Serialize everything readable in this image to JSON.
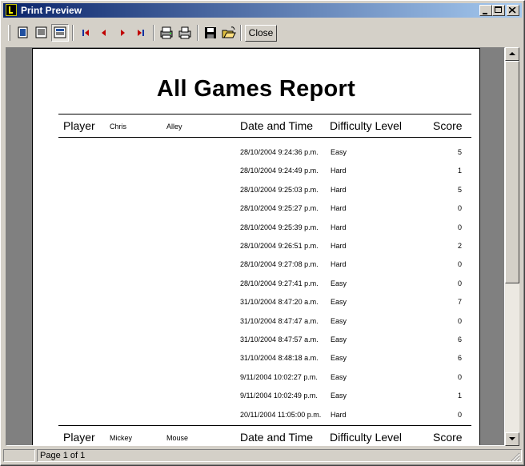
{
  "window": {
    "title": "Print Preview"
  },
  "toolbar": {
    "close_label": "Close"
  },
  "status": {
    "page_text": "Page 1 of 1"
  },
  "report": {
    "title": "All Games Report",
    "columns": {
      "player": "Player",
      "datetime": "Date and Time",
      "difficulty": "Difficulty Level",
      "score": "Score"
    },
    "groups": [
      {
        "first_name": "Chris",
        "last_name": "Alley",
        "rows": [
          {
            "datetime": "28/10/2004 9:24:36 p.m.",
            "difficulty": "Easy",
            "score": "5"
          },
          {
            "datetime": "28/10/2004 9:24:49 p.m.",
            "difficulty": "Hard",
            "score": "1"
          },
          {
            "datetime": "28/10/2004 9:25:03 p.m.",
            "difficulty": "Hard",
            "score": "5"
          },
          {
            "datetime": "28/10/2004 9:25:27 p.m.",
            "difficulty": "Hard",
            "score": "0"
          },
          {
            "datetime": "28/10/2004 9:25:39 p.m.",
            "difficulty": "Hard",
            "score": "0"
          },
          {
            "datetime": "28/10/2004 9:26:51 p.m.",
            "difficulty": "Hard",
            "score": "2"
          },
          {
            "datetime": "28/10/2004 9:27:08 p.m.",
            "difficulty": "Hard",
            "score": "0"
          },
          {
            "datetime": "28/10/2004 9:27:41 p.m.",
            "difficulty": "Easy",
            "score": "0"
          },
          {
            "datetime": "31/10/2004 8:47:20 a.m.",
            "difficulty": "Easy",
            "score": "7"
          },
          {
            "datetime": "31/10/2004 8:47:47 a.m.",
            "difficulty": "Easy",
            "score": "0"
          },
          {
            "datetime": "31/10/2004 8:47:57 a.m.",
            "difficulty": "Easy",
            "score": "6"
          },
          {
            "datetime": "31/10/2004 8:48:18 a.m.",
            "difficulty": "Easy",
            "score": "6"
          },
          {
            "datetime": "9/11/2004 10:02:27 p.m.",
            "difficulty": "Easy",
            "score": "0"
          },
          {
            "datetime": "9/11/2004 10:02:49 p.m.",
            "difficulty": "Easy",
            "score": "1"
          },
          {
            "datetime": "20/11/2004 11:05:00 p.m.",
            "difficulty": "Hard",
            "score": "0"
          }
        ]
      },
      {
        "first_name": "Mickey",
        "last_name": "Mouse",
        "rows": []
      }
    ]
  }
}
